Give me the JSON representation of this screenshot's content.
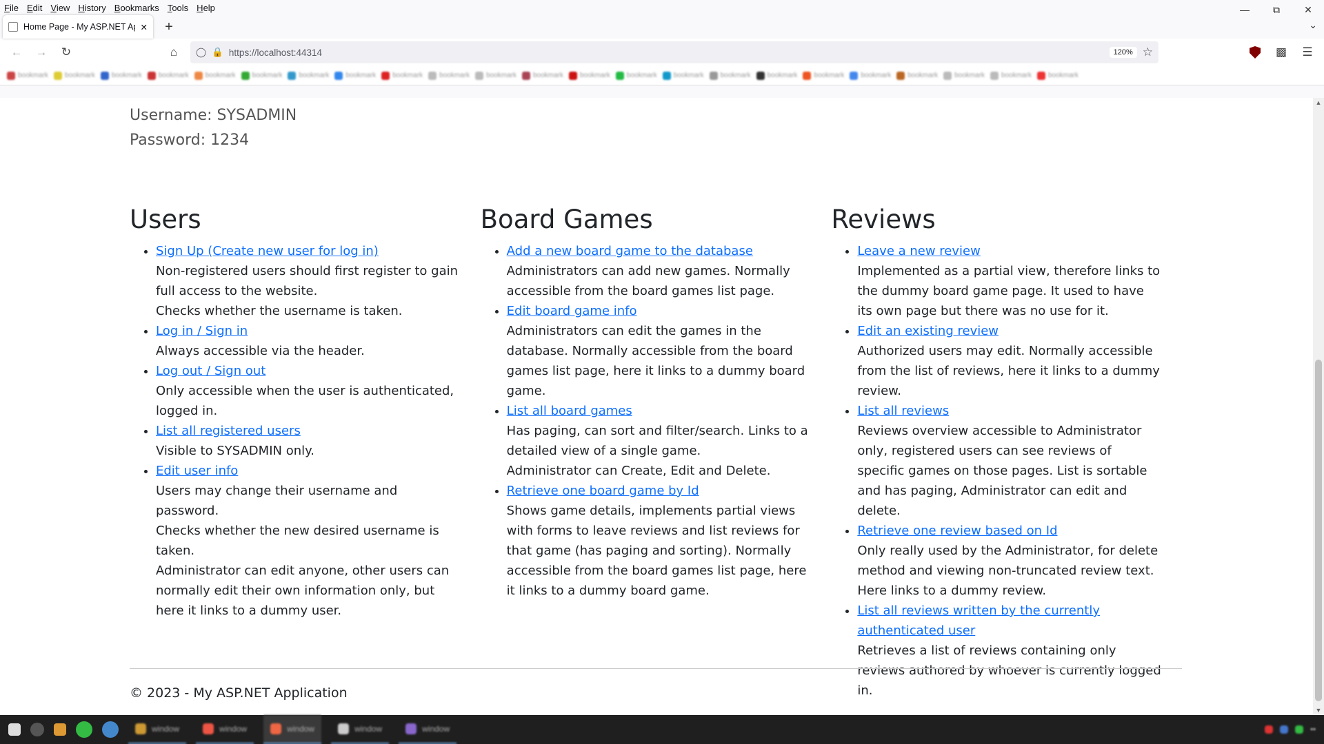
{
  "menubar": {
    "items": [
      "File",
      "Edit",
      "View",
      "History",
      "Bookmarks",
      "Tools",
      "Help"
    ]
  },
  "tab": {
    "title": "Home Page - My ASP.NET Appl",
    "close": "✕"
  },
  "newtab": "+",
  "navbar": {
    "url": "https://localhost:44314",
    "zoom": "120%"
  },
  "page": {
    "username_line": "Username: SYSADMIN",
    "password_line": "Password: 1234",
    "columns": [
      {
        "heading": "Users",
        "items": [
          {
            "link": "Sign Up (Create new user for log in)",
            "desc": [
              "Non-registered users should first register to gain full access to the website.",
              "Checks whether the username is taken."
            ]
          },
          {
            "link": "Log in / Sign in",
            "desc": [
              "Always accessible via the header."
            ]
          },
          {
            "link": "Log out / Sign out",
            "desc": [
              "Only accessible when the user is authenticated, logged in."
            ]
          },
          {
            "link": "List all registered users",
            "desc": [
              "Visible to SYSADMIN only."
            ]
          },
          {
            "link": "Edit user info",
            "desc": [
              "Users may change their username and password.",
              "Checks whether the new desired username is taken.",
              "Administrator can edit anyone, other users can normally edit their own information only, but here it links to a dummy user."
            ]
          }
        ]
      },
      {
        "heading": "Board Games",
        "items": [
          {
            "link": "Add a new board game to the database",
            "desc": [
              "Administrators can add new games. Normally accessible from the board games list page."
            ]
          },
          {
            "link": "Edit board game info",
            "desc": [
              "Administrators can edit the games in the database. Normally accessible from the board games list page, here it links to a dummy board game."
            ]
          },
          {
            "link": "List all board games",
            "desc": [
              "Has paging, can sort and filter/search. Links to a detailed view of a single game.",
              "Administrator can Create, Edit and Delete."
            ]
          },
          {
            "link": "Retrieve one board game by Id",
            "desc": [
              "Shows game details, implements partial views with forms to leave reviews and list reviews for that game (has paging and sorting). Normally accessible from the board games list page, here it links to a dummy board game."
            ]
          }
        ]
      },
      {
        "heading": "Reviews",
        "items": [
          {
            "link": "Leave a new review",
            "desc": [
              "Implemented as a partial view, therefore links to the dummy board game page. It used to have its own page but there was no use for it."
            ]
          },
          {
            "link": "Edit an existing review",
            "desc": [
              "Authorized users may edit. Normally accessible from the list of reviews, here it links to a dummy review."
            ]
          },
          {
            "link": "List all reviews",
            "desc": [
              "Reviews overview accessible to Administrator only, registered users can see reviews of specific games on those pages. List is sortable and has paging, Administrator can edit and delete."
            ]
          },
          {
            "link": "Retrieve one review based on Id",
            "desc": [
              "Only really used by the Administrator, for delete method and viewing non-truncated review text. Here links to a dummy review."
            ]
          },
          {
            "link": "List all reviews written by the currently authenticated user",
            "desc": [
              "Retrieves a list of reviews containing only reviews authored by whoever is currently logged in."
            ]
          }
        ]
      }
    ],
    "footer": "© 2023 - My ASP.NET Application"
  }
}
